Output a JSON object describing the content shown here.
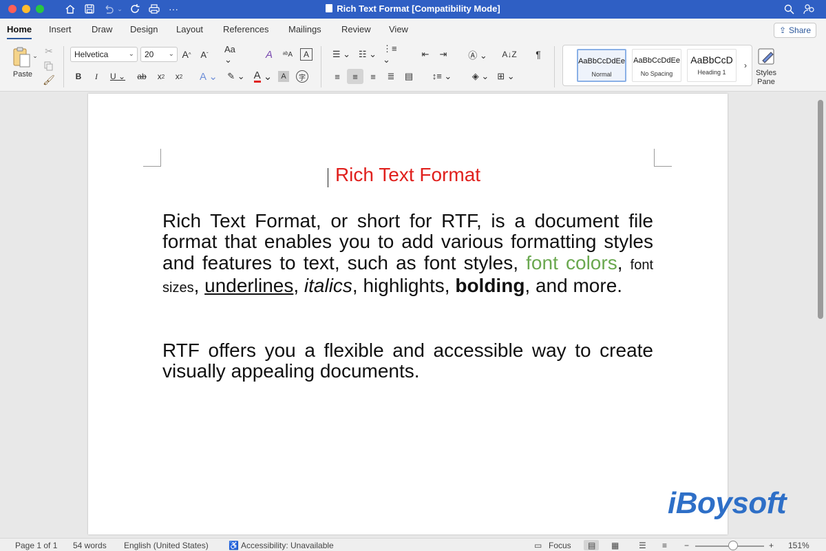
{
  "window": {
    "title": "Rich Text Format [Compatibility Mode]"
  },
  "quick_access": {
    "icons": [
      "home-icon",
      "save-icon",
      "undo-icon",
      "redo-icon",
      "print-icon",
      "more-icon"
    ]
  },
  "tabs": [
    {
      "label": "Home",
      "active": true
    },
    {
      "label": "Insert"
    },
    {
      "label": "Draw"
    },
    {
      "label": "Design"
    },
    {
      "label": "Layout"
    },
    {
      "label": "References"
    },
    {
      "label": "Mailings"
    },
    {
      "label": "Review"
    },
    {
      "label": "View"
    }
  ],
  "share_label": "Share",
  "ribbon": {
    "paste_label": "Paste",
    "font_name": "Helvetica",
    "font_size": "20",
    "styles": [
      {
        "sample": "AaBbCcDdEe",
        "name": "Normal",
        "selected": true
      },
      {
        "sample": "AaBbCcDdEe",
        "name": "No Spacing"
      },
      {
        "sample": "AaBbCcD",
        "name": "Heading 1"
      }
    ],
    "styles_pane_line1": "Styles",
    "styles_pane_line2": "Pane"
  },
  "document": {
    "title": "Rich Text Format",
    "title_color": "#e0201d",
    "p1": {
      "a": "Rich Text Format, or short for RTF, is a document file format that enables you to add various formatting styles and features to text, such as font styles, ",
      "green": "font colors",
      "c1": ", ",
      "small": "font sizes",
      "c2": ", ",
      "underlined": "underlines",
      "c3": ", ",
      "italic": "italics",
      "c4": ", highlights, ",
      "bold": "bolding",
      "c5": ", and more."
    },
    "p2": "RTF offers you a flexible and accessible way to create visually appealing documents."
  },
  "watermark": "iBoysoft",
  "status": {
    "page": "Page 1 of 1",
    "words": "54 words",
    "language": "English (United States)",
    "accessibility": "Accessibility: Unavailable",
    "focus": "Focus",
    "zoom": "151%"
  },
  "colors": {
    "titlebar": "#2f5fc4",
    "green_text": "#6aa84f",
    "accent": "#2b579a"
  }
}
